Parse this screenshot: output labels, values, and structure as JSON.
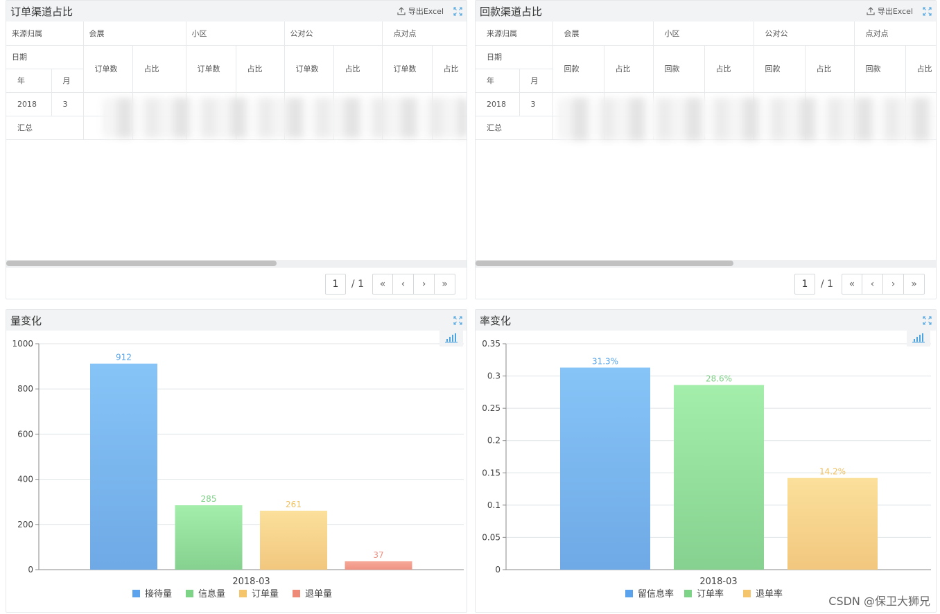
{
  "order_panel": {
    "title": "订单渠道占比",
    "export_label": "导出Excel",
    "header_row1": [
      "来源归属",
      "会展",
      "小区",
      "公对公",
      "点对点"
    ],
    "date_label": "日期",
    "year_label": "年",
    "month_label": "月",
    "sub_headers": [
      "订单数",
      "占比",
      "订单数",
      "占比",
      "订单数",
      "占比",
      "订单数",
      "占比"
    ],
    "row_year": "2018",
    "row_month": "3",
    "summary_label": "汇总",
    "pager": {
      "page": "1",
      "total": "/ 1"
    }
  },
  "refund_panel": {
    "title": "回款渠道占比",
    "export_label": "导出Excel",
    "header_row1": [
      "来源归属",
      "会展",
      "小区",
      "公对公",
      "点对点"
    ],
    "date_label": "日期",
    "year_label": "年",
    "month_label": "月",
    "sub_headers": [
      "回款",
      "占比",
      "回款",
      "占比",
      "回款",
      "占比",
      "回款",
      "占比"
    ],
    "row_year": "2018",
    "row_month": "3",
    "summary_label": "汇总",
    "pager": {
      "page": "1",
      "total": "/ 1"
    }
  },
  "volume_panel": {
    "title": "量变化"
  },
  "rate_panel": {
    "title": "率变化"
  },
  "pager_buttons": {
    "first": "«",
    "prev": "‹",
    "next": "›",
    "last": "»"
  },
  "watermark": "CSDN @保卫大狮兄",
  "colors": {
    "blue_top": "#86c4f7",
    "blue_bottom": "#6fa9e6",
    "green_top": "#a3eeaa",
    "green_bottom": "#86d18f",
    "yellow_top": "#fbe09b",
    "yellow_bottom": "#f2c77e",
    "red_top": "#f7a898",
    "red_bottom": "#ef9484",
    "label_blue": "#5aa5e8",
    "label_green": "#7ccf84",
    "label_yellow": "#f0c060",
    "label_red": "#ef8f7f",
    "legend_blue": "#5ba3ec",
    "legend_green": "#7dd386",
    "legend_yellow": "#f4c56a",
    "legend_red": "#ee8a78"
  },
  "chart_data": [
    {
      "type": "bar",
      "categories": [
        "2018-03"
      ],
      "series": [
        {
          "name": "接待量",
          "values": [
            912
          ]
        },
        {
          "name": "信息量",
          "values": [
            285
          ]
        },
        {
          "name": "订单量",
          "values": [
            261
          ]
        },
        {
          "name": "退单量",
          "values": [
            37
          ]
        }
      ],
      "data_labels": [
        "912",
        "285",
        "261",
        "37"
      ],
      "ylim": [
        0,
        1000
      ],
      "yticks": [
        "0",
        "200",
        "400",
        "600",
        "800",
        "1000"
      ],
      "grid": true,
      "legend_position": "bottom"
    },
    {
      "type": "bar",
      "categories": [
        "2018-03"
      ],
      "series": [
        {
          "name": "留信息率",
          "values": [
            0.313
          ]
        },
        {
          "name": "订单率",
          "values": [
            0.286
          ]
        },
        {
          "name": "退单率",
          "values": [
            0.142
          ]
        }
      ],
      "data_labels": [
        "31.3%",
        "28.6%",
        "14.2%"
      ],
      "ylim": [
        0,
        0.35
      ],
      "yticks": [
        "0",
        "0.05",
        "0.1",
        "0.15",
        "0.2",
        "0.25",
        "0.3",
        "0.35"
      ],
      "grid": true,
      "legend_position": "bottom"
    }
  ]
}
